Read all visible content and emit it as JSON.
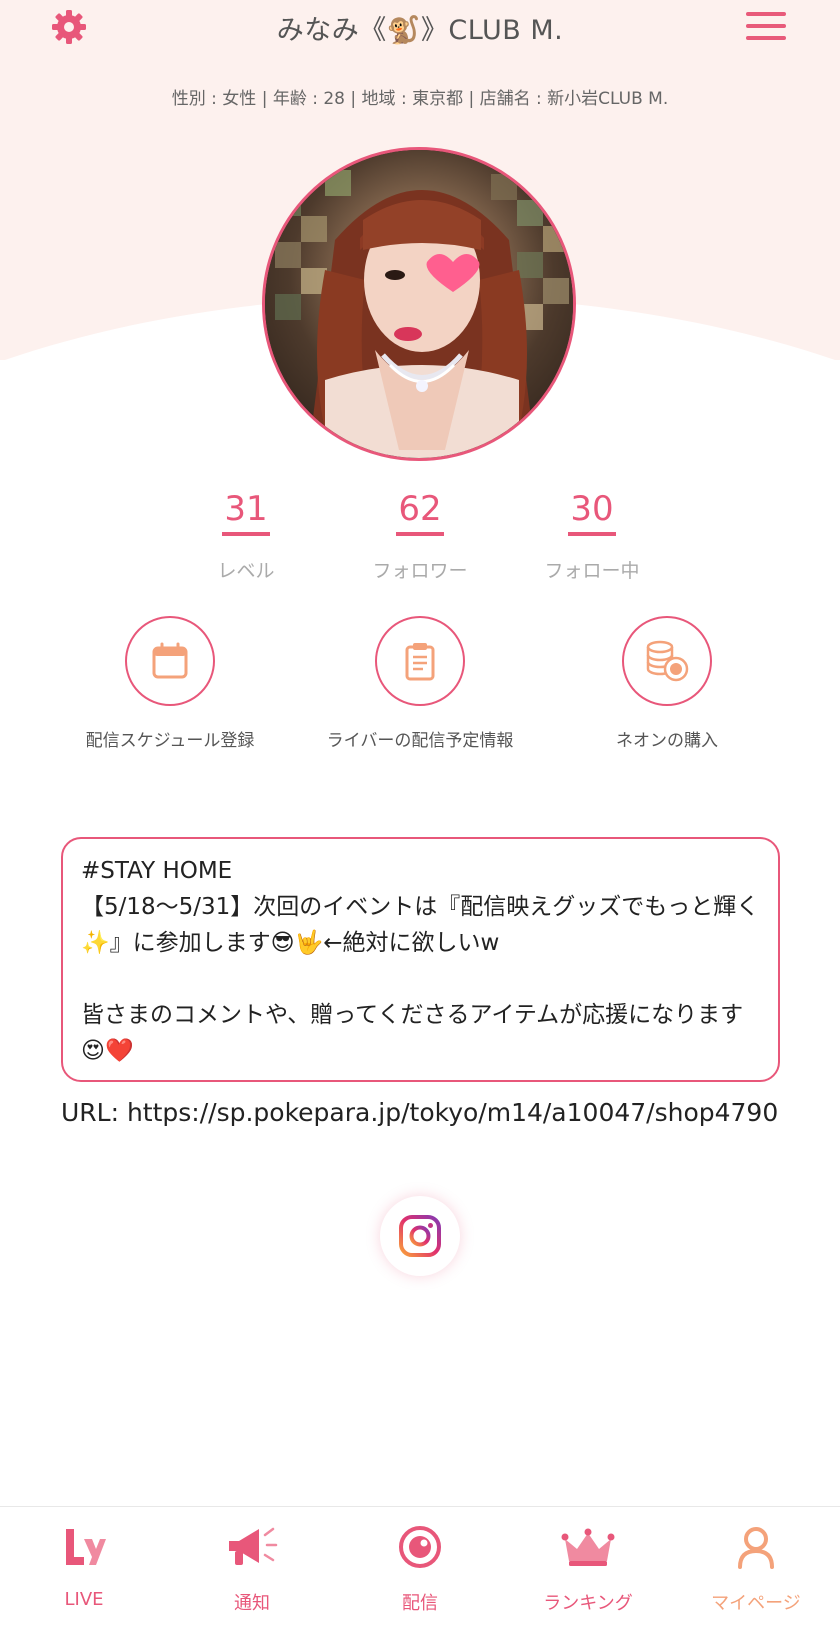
{
  "header": {
    "title": "みなみ《🐒》CLUB M.",
    "settings_icon": "gear-icon",
    "menu_icon": "hamburger-menu-icon"
  },
  "profile": {
    "info_line": "性別 : 女性 | 年齢 : 28 | 地域 : 東京都 | 店舗名 : 新小岩CLUB M."
  },
  "stats": [
    {
      "value": "31",
      "label": "レベル"
    },
    {
      "value": "62",
      "label": "フォロワー"
    },
    {
      "value": "30",
      "label": "フォロー中"
    }
  ],
  "actions": [
    {
      "label": "配信スケジュール登録",
      "icon": "calendar-icon"
    },
    {
      "label": "ライバーの配信予定情報",
      "icon": "clipboard-icon"
    },
    {
      "label": "ネオンの購入",
      "icon": "coins-icon"
    }
  ],
  "bio": {
    "text": "#STAY HOME\n【5/18〜5/31】次回のイベントは『配信映えグッズでもっと輝く✨』に参加します😎🤟←絶対に欲しいw\n\n皆さまのコメントや、贈ってくださるアイテムが応援になります😍❤️"
  },
  "url": {
    "text": "URL: https://sp.pokepara.jp/tokyo/m14/a10047/shop4790"
  },
  "social": {
    "icon": "instagram-icon"
  },
  "bottom_nav": [
    {
      "label": "LIVE",
      "icon": "ly-logo-icon"
    },
    {
      "label": "通知",
      "icon": "megaphone-icon"
    },
    {
      "label": "配信",
      "icon": "broadcast-icon"
    },
    {
      "label": "ランキング",
      "icon": "crown-icon"
    },
    {
      "label": "マイページ",
      "icon": "person-icon"
    }
  ],
  "colors": {
    "accent": "#e8577a",
    "header_bg": "#fdf1ee",
    "icon_orange": "#f4a27a"
  }
}
